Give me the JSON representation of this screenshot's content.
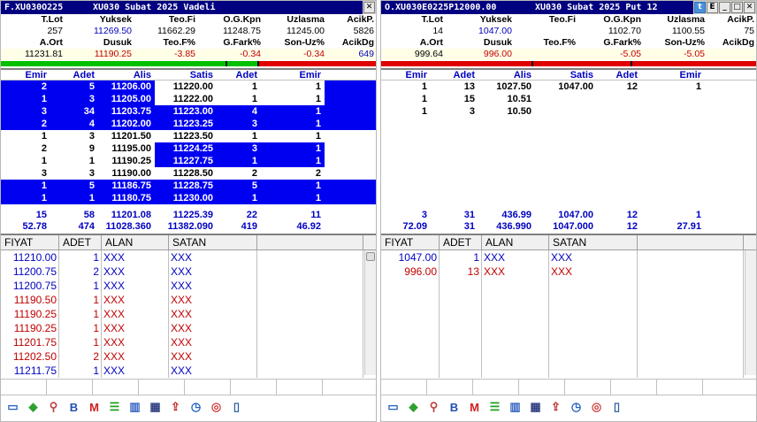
{
  "left": {
    "title_code": "F.XU030O225",
    "title_desc": "XU030 Subat 2025 Vadeli",
    "info": {
      "row1_labels": [
        "T.Lot",
        "Yuksek",
        "Teo.Fi",
        "O.G.Kpn",
        "Uzlasma",
        "AcikP."
      ],
      "row1_values": [
        "257",
        "11269.50",
        "11662.29",
        "11248.75",
        "11245.00",
        "5826"
      ],
      "row2_labels": [
        "A.Ort",
        "Dusuk",
        "Teo.F%",
        "G.Fark%",
        "Son-Uz%",
        "AcikDg"
      ],
      "row2_values": [
        "11231.81",
        "11190.25",
        "-3.85",
        "-0.34",
        "-0.34",
        "649"
      ]
    },
    "depth_headers": [
      "Emir",
      "Adet",
      "Alis",
      "Satis",
      "Adet",
      "Emir"
    ],
    "depth_rows": [
      {
        "e1": "2",
        "a1": "5",
        "alis": "11206.00",
        "sat": "11220.00",
        "a2": "1",
        "e2": "1",
        "style": "hl"
      },
      {
        "e1": "1",
        "a1": "3",
        "alis": "11205.00",
        "sat": "11222.00",
        "a2": "1",
        "e2": "1",
        "style": "hl"
      },
      {
        "e1": "3",
        "a1": "34",
        "alis": "11203.75",
        "sat": "11223.00",
        "a2": "4",
        "e2": "1",
        "style": "full"
      },
      {
        "e1": "2",
        "a1": "4",
        "alis": "11202.00",
        "sat": "11223.25",
        "a2": "3",
        "e2": "1",
        "style": "full"
      },
      {
        "e1": "1",
        "a1": "3",
        "alis": "11201.50",
        "sat": "11223.50",
        "a2": "1",
        "e2": "1",
        "style": "plain"
      },
      {
        "e1": "2",
        "a1": "9",
        "alis": "11195.00",
        "sat": "11224.25",
        "a2": "3",
        "e2": "1",
        "style": "satfull"
      },
      {
        "e1": "1",
        "a1": "1",
        "alis": "11190.25",
        "sat": "11227.75",
        "a2": "1",
        "e2": "1",
        "style": "satfull"
      },
      {
        "e1": "3",
        "a1": "3",
        "alis": "11190.00",
        "sat": "11228.50",
        "a2": "2",
        "e2": "2",
        "style": "plain"
      },
      {
        "e1": "1",
        "a1": "5",
        "alis": "11186.75",
        "sat": "11228.75",
        "a2": "5",
        "e2": "1",
        "style": "full"
      },
      {
        "e1": "1",
        "a1": "1",
        "alis": "11180.75",
        "sat": "11230.00",
        "a2": "1",
        "e2": "1",
        "style": "full"
      }
    ],
    "totals1": [
      "15",
      "58",
      "11201.08",
      "11225.39",
      "22",
      "11"
    ],
    "totals2": [
      "52.78",
      "474",
      "11028.360",
      "11382.090",
      "419",
      "46.92"
    ],
    "trade_headers": [
      "FIYAT",
      "ADET",
      "ALAN",
      "SATAN"
    ],
    "trades": [
      {
        "price": "11210.00",
        "qty": "1",
        "buyer": "XXX",
        "seller": "XXX",
        "dir": "up"
      },
      {
        "price": "11200.75",
        "qty": "2",
        "buyer": "XXX",
        "seller": "XXX",
        "dir": "up"
      },
      {
        "price": "11200.75",
        "qty": "1",
        "buyer": "XXX",
        "seller": "XXX",
        "dir": "up"
      },
      {
        "price": "11190.50",
        "qty": "1",
        "buyer": "XXX",
        "seller": "XXX",
        "dir": "down"
      },
      {
        "price": "11190.25",
        "qty": "1",
        "buyer": "XXX",
        "seller": "XXX",
        "dir": "down"
      },
      {
        "price": "11190.25",
        "qty": "1",
        "buyer": "XXX",
        "seller": "XXX",
        "dir": "down"
      },
      {
        "price": "11201.75",
        "qty": "1",
        "buyer": "XXX",
        "seller": "XXX",
        "dir": "down"
      },
      {
        "price": "11202.50",
        "qty": "2",
        "buyer": "XXX",
        "seller": "XXX",
        "dir": "down"
      },
      {
        "price": "11211.75",
        "qty": "1",
        "buyer": "XXX",
        "seller": "XXX",
        "dir": "up"
      }
    ]
  },
  "right": {
    "title_code": "O.XU030E0225P12000.00",
    "title_desc": "XU030 Subat 2025 Put 12",
    "info": {
      "row1_labels": [
        "T.Lot",
        "Yuksek",
        "Teo.Fi",
        "O.G.Kpn",
        "Uzlasma",
        "AcikP."
      ],
      "row1_values": [
        "14",
        "1047.00",
        "",
        "1102.70",
        "1100.55",
        "75"
      ],
      "row2_labels": [
        "A.Ort",
        "Dusuk",
        "Teo.F%",
        "G.Fark%",
        "Son-Uz%",
        "AcikDg"
      ],
      "row2_values": [
        "999.64",
        "996.00",
        "",
        "-5.05",
        "-5.05",
        ""
      ]
    },
    "depth_headers": [
      "Emir",
      "Adet",
      "Alis",
      "Satis",
      "Adet",
      "Emir"
    ],
    "depth_rows": [
      {
        "e1": "1",
        "a1": "13",
        "alis": "1027.50",
        "sat": "1047.00",
        "a2": "12",
        "e2": "1",
        "style": "plain"
      },
      {
        "e1": "1",
        "a1": "15",
        "alis": "10.51",
        "sat": "",
        "a2": "",
        "e2": "",
        "style": "plain"
      },
      {
        "e1": "1",
        "a1": "3",
        "alis": "10.50",
        "sat": "",
        "a2": "",
        "e2": "",
        "style": "plain"
      }
    ],
    "totals1": [
      "3",
      "31",
      "436.99",
      "1047.00",
      "12",
      "1"
    ],
    "totals2": [
      "72.09",
      "31",
      "436.990",
      "1047.000",
      "12",
      "27.91"
    ],
    "trade_headers": [
      "FIYAT",
      "ADET",
      "ALAN",
      "SATAN"
    ],
    "trades": [
      {
        "price": "1047.00",
        "qty": "1",
        "buyer": "XXX",
        "seller": "XXX",
        "dir": "up"
      },
      {
        "price": "996.00",
        "qty": "13",
        "buyer": "XXX",
        "seller": "XXX",
        "dir": "down"
      }
    ]
  },
  "toolbar_icons": [
    "monitor-icon",
    "cube-icon",
    "search-doc-icon",
    "bold-b-icon",
    "mail-icon",
    "list-lines-icon",
    "bar-chart-icon",
    "table-icon",
    "upload-icon",
    "clock-icon",
    "globe-icon",
    "book-icon"
  ],
  "colors": {
    "title_bg": "#000080",
    "highlight": "#0000f0",
    "up": "#0000c0",
    "down": "#c00000"
  }
}
